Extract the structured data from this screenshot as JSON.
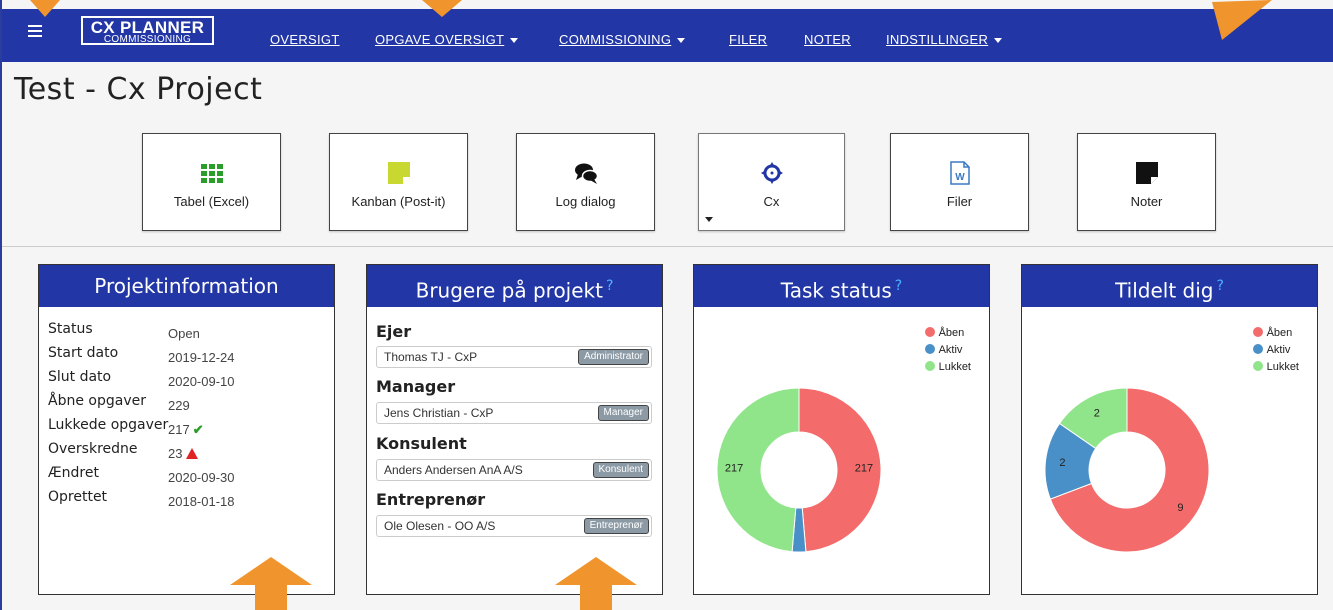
{
  "navbar": {
    "logo_line1": "CX PLANNER",
    "logo_line2": "COMMISSIONING",
    "items": [
      "OVERSIGT",
      "OPGAVE OVERSIGT",
      "COMMISSIONING",
      "FILER",
      "NOTER",
      "INDSTILLINGER"
    ]
  },
  "page_title": "Test - Cx Project",
  "quick_buttons": [
    {
      "label": "Tabel (Excel)",
      "icon": "grid-icon"
    },
    {
      "label": "Kanban (Post-it)",
      "icon": "sticky-note-icon"
    },
    {
      "label": "Log dialog",
      "icon": "comments-icon"
    },
    {
      "label": "Cx",
      "icon": "crosshairs-icon"
    },
    {
      "label": "Filer",
      "icon": "word-file-icon"
    },
    {
      "label": "Noter",
      "icon": "note-icon"
    }
  ],
  "projektinfo": {
    "title": "Projektinformation",
    "rows": [
      {
        "label": "Status",
        "value": "Open"
      },
      {
        "label": "Start dato",
        "value": "2019-12-24"
      },
      {
        "label": "Slut dato",
        "value": "2020-09-10"
      },
      {
        "label": "Åbne opgaver",
        "value": "229"
      },
      {
        "label": "Lukkede opgaver",
        "value": "217"
      },
      {
        "label": "Overskredne",
        "value": "23"
      },
      {
        "label": "Ændret",
        "value": "2020-09-30"
      },
      {
        "label": "Oprettet",
        "value": "2018-01-18"
      }
    ]
  },
  "brugere": {
    "title": "Brugere på projekt",
    "help": "?",
    "groups": [
      {
        "role": "Ejer",
        "user": "Thomas TJ - CxP",
        "badge": "Administrator"
      },
      {
        "role": "Manager",
        "user": "Jens Christian - CxP",
        "badge": "Manager"
      },
      {
        "role": "Konsulent",
        "user": "Anders Andersen AnA A/S",
        "badge": "Konsulent"
      },
      {
        "role": "Entreprenør",
        "user": "Ole Olesen - OO A/S",
        "badge": "Entreprenør"
      }
    ]
  },
  "colors": {
    "aaben": "#f46b6b",
    "aktiv": "#4a90c8",
    "lukket": "#90e48a",
    "brand": "#2237a5"
  },
  "chart_data": [
    {
      "type": "pie",
      "title": "Task status",
      "categories": [
        "Åben",
        "Aktiv",
        "Lukket"
      ],
      "values": [
        217,
        12,
        217
      ],
      "data_labels": [
        "217",
        "",
        "217"
      ]
    },
    {
      "type": "pie",
      "title": "Tildelt dig",
      "categories": [
        "Åben",
        "Aktiv",
        "Lukket"
      ],
      "values": [
        9,
        2,
        2
      ],
      "data_labels": [
        "9",
        "2",
        "2"
      ]
    }
  ]
}
